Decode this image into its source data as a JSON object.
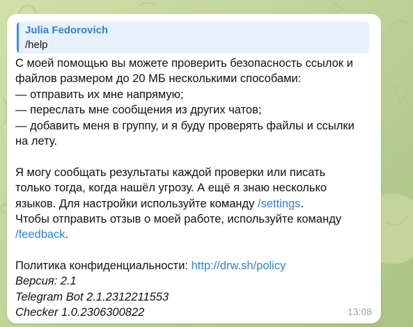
{
  "reply": {
    "author": "Julia Fedorovich",
    "text": "/help"
  },
  "message": {
    "lines": [
      "С моей помощью вы можете проверить безопасность ссылок и",
      "файлов размером до 20 МБ несколькими способами:",
      "— отправить их мне напрямую;",
      "— переслать мне сообщения из других чатов;",
      "— добавить меня в группу, и я буду проверять файлы и ссылки",
      "на лету.",
      "Я могу сообщать результаты каждой проверки или писать",
      "только тогда, когда нашёл угрозу. А ещё я знаю несколько",
      "языков. Для настройки используйте команду ",
      "Чтобы отправить отзыв о моей работе, используйте команду",
      "Политика конфиденциальности: "
    ],
    "settings_link": "/settings",
    "settings_after": ".",
    "feedback_link": "/feedback",
    "feedback_after": ".",
    "policy_link": "http://drw.sh/policy",
    "version": "Версия: 2.1",
    "bot_version": "Telegram Bot 2.1.2312211553",
    "checker_version": "Checker 1.0.2306300822"
  },
  "time": "13:08",
  "colors": {
    "link": "#2f82d8",
    "reply_bar": "#3a8ee6",
    "reply_bg": "#e8f1fb",
    "bubble": "#ffffff",
    "background": "#c9d9a6"
  }
}
